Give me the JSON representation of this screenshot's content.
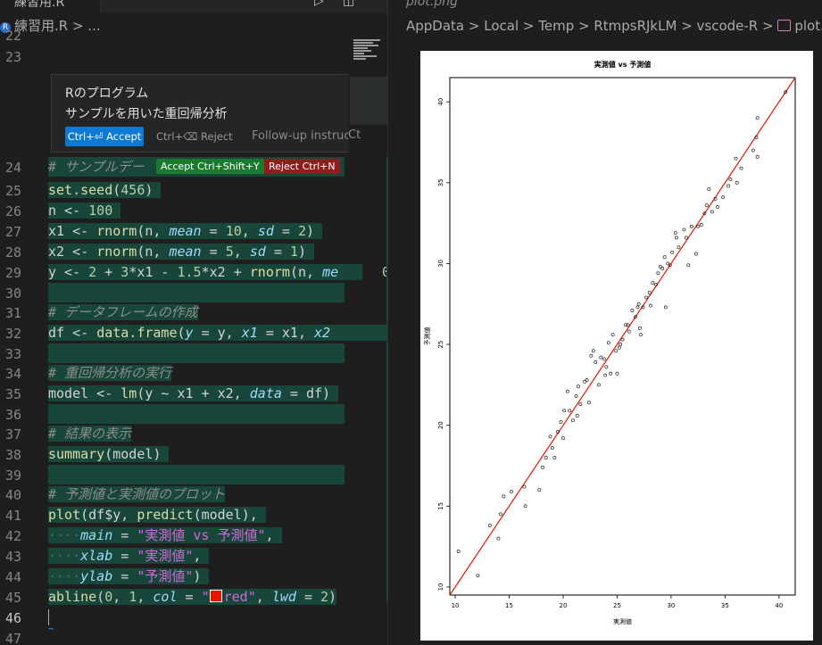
{
  "left_editor": {
    "tab_label": "練習用.R",
    "breadcrumb": "練習用.R > ...",
    "top_line_numbers": [
      "22",
      "23"
    ],
    "inline_chat": {
      "title": "Rのプログラム",
      "subtitle": "サンプルを用いた重回帰分析",
      "accept_label": "Ctrl+⏎ Accept",
      "reject_label": "Ctrl+⌫ Reject",
      "followup_placeholder": "Follow-up instruc",
      "followup_tail": "Ct"
    },
    "diff_accept_chip": "Accept Ctrl+Shift+Y",
    "diff_reject_chip": "Reject Ctrl+N",
    "line_numbers": [
      "24",
      "25",
      "26",
      "27",
      "28",
      "29",
      "30",
      "31",
      "32",
      "33",
      "34",
      "35",
      "36",
      "37",
      "38",
      "39",
      "40",
      "41",
      "42",
      "43",
      "44",
      "45",
      "46",
      "47"
    ],
    "code": {
      "l24": "# サンプルデー",
      "l25": "set.seed(456)",
      "l26a": "n <- ",
      "l26b": "100",
      "l27a": "x1 <- ",
      "l27b": "rnorm",
      "l27c": "(n, ",
      "l27d": "mean",
      "l27e": " = ",
      "l27f": "10",
      "l27g": ", ",
      "l27h": "sd",
      "l27i": " = ",
      "l27j": "2",
      "l27k": ")",
      "l28a": "x2 <- ",
      "l28b": "rnorm",
      "l28c": "(n, ",
      "l28d": "mean",
      "l28e": " = ",
      "l28f": "5",
      "l28g": ", ",
      "l28h": "sd",
      "l28i": " = ",
      "l28j": "1",
      "l28k": ")",
      "l29a": "y <- ",
      "l29b": "2",
      "l29c": " + ",
      "l29d": "3",
      "l29e": "*x1 - ",
      "l29f": "1.5",
      "l29g": "*x2 + ",
      "l29h": "rnorm",
      "l29i": "(n, ",
      "l29j": "me",
      "l29k": "0",
      "l31": "# データフレームの作成",
      "l32a": "df <- ",
      "l32b": "data.frame",
      "l32c": "(",
      "l32d": "y",
      "l32e": " = y, ",
      "l32f": "x1",
      "l32g": " = x1, ",
      "l32h": "x2",
      "l34": "# 重回帰分析の実行",
      "l35a": "model <- ",
      "l35b": "lm",
      "l35c": "(y ~ x1 + x2, ",
      "l35d": "data",
      "l35e": " = df)",
      "l37": "# 結果の表示",
      "l38a": "summary",
      "l38b": "(model)",
      "l40": "# 予測値と実測値のプロット",
      "l41a": "plot",
      "l41b": "(df$y, ",
      "l41c": "predict",
      "l41d": "(model),",
      "l42a": "main",
      "l42b": " = ",
      "l42c": "\"実測値 vs 予測値\"",
      "l42d": ",",
      "l43a": "xlab",
      "l43b": " = ",
      "l43c": "\"実測値\"",
      "l43d": ",",
      "l44a": "ylab",
      "l44b": " = ",
      "l44c": "\"予測値\"",
      "l44d": ")",
      "l45a": "abline",
      "l45b": "(",
      "l45c": "0",
      "l45d": ", ",
      "l45e": "1",
      "l45f": ", ",
      "l45g": "col",
      "l45h": " = ",
      "l45i": "\"",
      "l45j": "red\"",
      "l45k": ", ",
      "l45l": "lwd",
      "l45m": " = ",
      "l45n": "2",
      "l45o": ")"
    }
  },
  "right_editor": {
    "tab_label": "plot.png",
    "breadcrumb": [
      "AppData",
      "Local",
      "Temp",
      "RtmpsRJkLM",
      "vscode-R",
      "plot.png"
    ]
  },
  "colors": {
    "editor_bg": "#1e1e1e",
    "diff_added_bg": "#19463a",
    "accept_button": "#0e7ad3",
    "accept_chip": "#1a7a2e",
    "reject_chip": "#8f1d1d",
    "abline": "#e51400"
  },
  "chart_data": {
    "type": "scatter",
    "title": "実測値 vs 予測値",
    "xlabel": "実測値",
    "ylabel": "予測値",
    "xlim": [
      9.5,
      41.5
    ],
    "ylim": [
      9.5,
      41.5
    ],
    "x_ticks": [
      "10",
      "15",
      "20",
      "25",
      "30",
      "35",
      "40"
    ],
    "y_ticks": [
      "10",
      "15",
      "20",
      "25",
      "30",
      "35",
      "40"
    ],
    "points": [
      [
        10.3,
        12.2
      ],
      [
        12.1,
        10.7
      ],
      [
        13.2,
        13.8
      ],
      [
        14.0,
        13.0
      ],
      [
        14.2,
        14.5
      ],
      [
        14.5,
        15.6
      ],
      [
        15.2,
        15.9
      ],
      [
        16.5,
        15.0
      ],
      [
        16.4,
        16.2
      ],
      [
        17.8,
        16.0
      ],
      [
        18.1,
        17.4
      ],
      [
        18.4,
        18.0
      ],
      [
        18.8,
        19.3
      ],
      [
        19.0,
        18.6
      ],
      [
        19.2,
        18.0
      ],
      [
        19.5,
        19.6
      ],
      [
        19.8,
        20.2
      ],
      [
        20.1,
        20.9
      ],
      [
        20.0,
        19.2
      ],
      [
        20.4,
        22.1
      ],
      [
        20.6,
        20.9
      ],
      [
        20.9,
        20.3
      ],
      [
        21.2,
        21.8
      ],
      [
        21.4,
        22.4
      ],
      [
        21.3,
        20.6
      ],
      [
        21.6,
        21.3
      ],
      [
        22.0,
        22.7
      ],
      [
        22.2,
        22.8
      ],
      [
        22.4,
        21.4
      ],
      [
        22.6,
        24.3
      ],
      [
        22.8,
        24.6
      ],
      [
        23.0,
        23.9
      ],
      [
        23.3,
        22.5
      ],
      [
        23.5,
        24.2
      ],
      [
        23.8,
        24.1
      ],
      [
        23.9,
        23.1
      ],
      [
        24.0,
        23.6
      ],
      [
        24.2,
        25.1
      ],
      [
        24.4,
        23.2
      ],
      [
        24.6,
        25.6
      ],
      [
        24.9,
        24.6
      ],
      [
        25.0,
        23.2
      ],
      [
        25.2,
        24.8
      ],
      [
        25.3,
        25.0
      ],
      [
        25.5,
        25.3
      ],
      [
        25.8,
        26.2
      ],
      [
        26.0,
        26.2
      ],
      [
        26.1,
        25.8
      ],
      [
        26.4,
        27.1
      ],
      [
        26.7,
        26.7
      ],
      [
        26.9,
        27.3
      ],
      [
        27.0,
        27.5
      ],
      [
        27.1,
        26.0
      ],
      [
        27.2,
        25.6
      ],
      [
        27.4,
        27.3
      ],
      [
        27.7,
        27.9
      ],
      [
        28.0,
        28.2
      ],
      [
        28.1,
        27.4
      ],
      [
        28.3,
        28.8
      ],
      [
        28.6,
        28.7
      ],
      [
        28.8,
        29.4
      ],
      [
        29.0,
        29.8
      ],
      [
        29.2,
        29.7
      ],
      [
        29.4,
        30.4
      ],
      [
        29.5,
        27.3
      ],
      [
        29.7,
        30.0
      ],
      [
        29.9,
        29.9
      ],
      [
        30.1,
        30.7
      ],
      [
        30.4,
        31.9
      ],
      [
        30.5,
        31.6
      ],
      [
        30.7,
        31.0
      ],
      [
        31.2,
        32.1
      ],
      [
        31.4,
        31.6
      ],
      [
        31.6,
        29.9
      ],
      [
        31.9,
        32.3
      ],
      [
        32.3,
        30.6
      ],
      [
        32.5,
        32.3
      ],
      [
        32.8,
        32.4
      ],
      [
        33.1,
        33.1
      ],
      [
        33.3,
        33.6
      ],
      [
        33.5,
        34.6
      ],
      [
        33.8,
        33.2
      ],
      [
        34.1,
        34.0
      ],
      [
        34.3,
        33.5
      ],
      [
        34.8,
        34.1
      ],
      [
        35.3,
        34.8
      ],
      [
        35.5,
        35.2
      ],
      [
        36.0,
        36.5
      ],
      [
        36.1,
        35.0
      ],
      [
        36.5,
        35.9
      ],
      [
        37.6,
        37.0
      ],
      [
        37.9,
        37.8
      ],
      [
        38.0,
        36.6
      ],
      [
        38.0,
        39.0
      ],
      [
        40.6,
        40.6
      ]
    ],
    "reference_line": {
      "intercept": 0,
      "slope": 1,
      "color": "red"
    },
    "grid": false,
    "legend": "none"
  }
}
